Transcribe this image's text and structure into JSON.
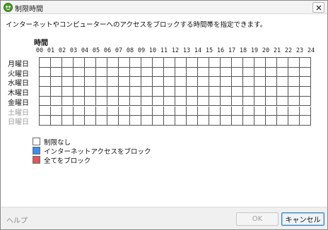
{
  "window": {
    "title": "制限時間",
    "colors": {
      "icon_green": "#4a9a2a",
      "titlebar": "#f3f3f3"
    }
  },
  "description": "インターネットやコンピューターへのアクセスをブロックする時間帯を指定できます。",
  "grid": {
    "header": "時間",
    "hours": [
      "00",
      "01",
      "02",
      "03",
      "04",
      "05",
      "06",
      "07",
      "08",
      "09",
      "10",
      "11",
      "12",
      "13",
      "14",
      "15",
      "16",
      "17",
      "18",
      "19",
      "20",
      "21",
      "22",
      "23",
      "24"
    ],
    "days": [
      {
        "label": "月曜日",
        "weekend": false
      },
      {
        "label": "火曜日",
        "weekend": false
      },
      {
        "label": "水曜日",
        "weekend": false
      },
      {
        "label": "木曜日",
        "weekend": false
      },
      {
        "label": "金曜日",
        "weekend": false
      },
      {
        "label": "土曜日",
        "weekend": true
      },
      {
        "label": "日曜日",
        "weekend": true
      }
    ]
  },
  "legend": [
    {
      "label": "制限なし",
      "color": "#ffffff"
    },
    {
      "label": "インターネットアクセスをブロック",
      "color": "#3d8fe8"
    },
    {
      "label": "全てをブロック",
      "color": "#e0565b"
    }
  ],
  "footer": {
    "help_label": "ヘルプ",
    "ok_label": "OK",
    "cancel_label": "キャンセル"
  }
}
